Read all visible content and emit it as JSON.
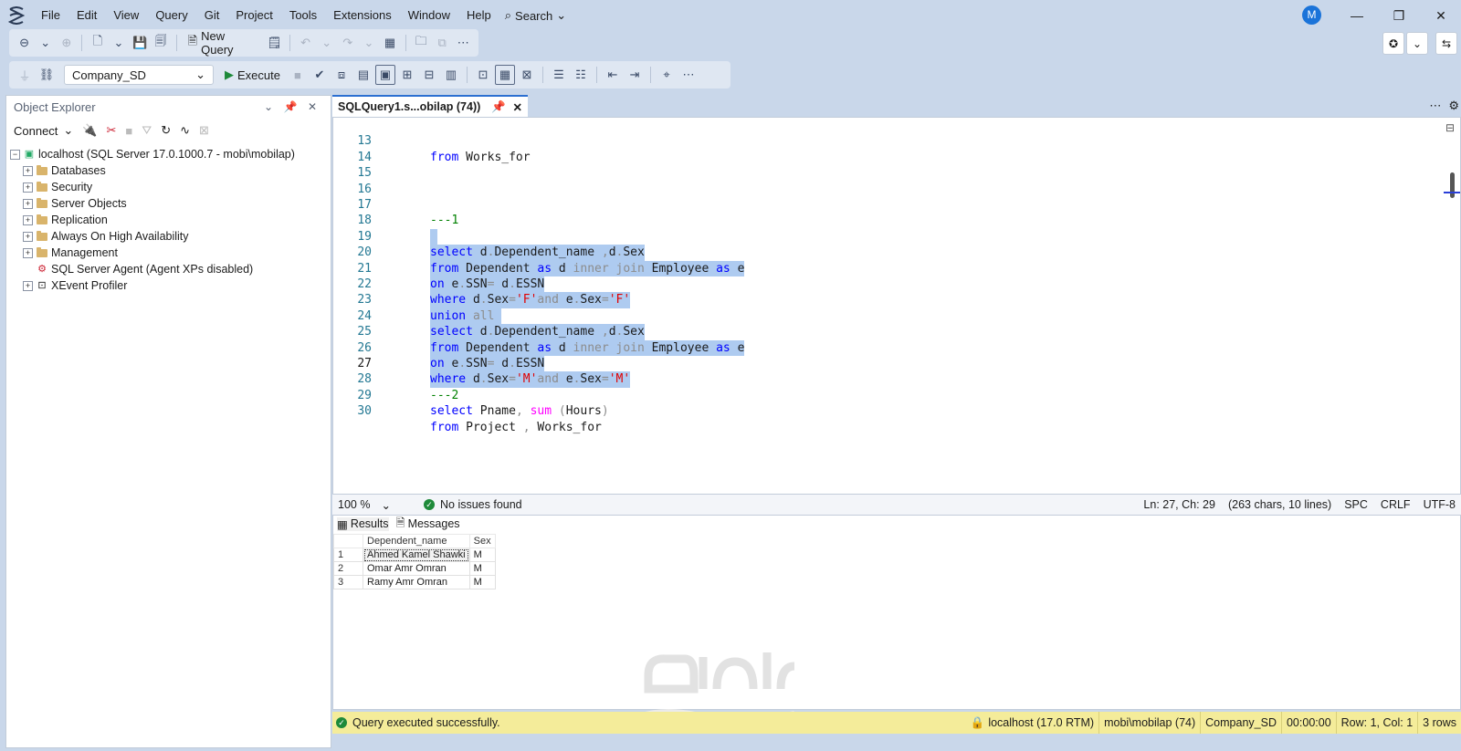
{
  "menu": [
    "File",
    "Edit",
    "View",
    "Query",
    "Git",
    "Project",
    "Tools",
    "Extensions",
    "Window",
    "Help"
  ],
  "search_label": "Search",
  "avatar_initial": "M",
  "toolbar": {
    "new_query": "New Query",
    "database": "Company_SD",
    "execute": "Execute"
  },
  "object_explorer": {
    "title": "Object Explorer",
    "connect": "Connect",
    "server": "localhost (SQL Server 17.0.1000.7 - mobi\\mobilap)",
    "nodes": [
      "Databases",
      "Security",
      "Server Objects",
      "Replication",
      "Always On High Availability",
      "Management",
      "SQL Server Agent (Agent XPs disabled)",
      "XEvent Profiler"
    ]
  },
  "editor": {
    "tab_title": "SQLQuery1.s...obilap (74))",
    "line_numbers": [
      "13",
      "14",
      "15",
      "16",
      "17",
      "18",
      "19",
      "20",
      "21",
      "22",
      "23",
      "24",
      "25",
      "26",
      "27",
      "28",
      "29",
      "30"
    ],
    "code": {
      "l13": [
        "from",
        " Works_for"
      ],
      "l17": "---1",
      "l19": [
        "select",
        " d",
        ".",
        "Dependent_name ",
        ",",
        "d",
        ".",
        "Sex"
      ],
      "l20": [
        "from",
        " Dependent ",
        "as",
        " d ",
        "inner join",
        " Employee ",
        "as",
        " e"
      ],
      "l21": [
        "on",
        " e",
        ".",
        "SSN",
        "=",
        " d",
        ".",
        "ESSN"
      ],
      "l22": [
        "where",
        " d",
        ".",
        "Sex",
        "=",
        "'F'",
        "and",
        " e",
        ".",
        "Sex",
        "=",
        "'F'"
      ],
      "l23": [
        "union",
        " all"
      ],
      "l24": [
        "select",
        " d",
        ".",
        "Dependent_name ",
        ",",
        "d",
        ".",
        "Sex"
      ],
      "l25": [
        "from",
        " Dependent ",
        "as",
        " d ",
        "inner join",
        " Employee ",
        "as",
        " e"
      ],
      "l26": [
        "on",
        " e",
        ".",
        "SSN",
        "=",
        " d",
        ".",
        "ESSN"
      ],
      "l27": [
        "where",
        " d",
        ".",
        "Sex",
        "=",
        "'M'",
        "and",
        " e",
        ".",
        "Sex",
        "=",
        "'M'"
      ],
      "l28": "---2",
      "l29": [
        "select",
        " Pname",
        ",",
        " sum",
        " (",
        "Hours",
        ")"
      ],
      "l30": [
        "from",
        " Project ",
        ",",
        " Works_for"
      ]
    }
  },
  "editor_status": {
    "zoom": "100 %",
    "issues": "No issues found",
    "position": "Ln: 27, Ch: 29",
    "chars": "(263 chars, 10 lines)",
    "spacing": "SPC",
    "eol": "CRLF",
    "encoding": "UTF-8"
  },
  "results": {
    "tab_results": "Results",
    "tab_messages": "Messages",
    "columns": [
      "Dependent_name",
      "Sex"
    ],
    "rows": [
      [
        "1",
        "Ahmed Kamel Shawki",
        "M"
      ],
      [
        "2",
        "Omar Amr Omran",
        "M"
      ],
      [
        "3",
        "Ramy Amr Omran",
        "M"
      ]
    ]
  },
  "status": {
    "message": "Query executed successfully.",
    "server": "localhost (17.0 RTM)",
    "user": "mobi\\mobilap (74)",
    "database": "Company_SD",
    "elapsed": "00:00:00",
    "rowcol": "Row: 1, Col: 1",
    "rows": "3 rows"
  },
  "colors": {
    "keyword": "#0000ff",
    "function": "#ff00ff",
    "string": "#e00000",
    "comment": "#008000",
    "selection": "#aecbf0",
    "status_bar": "#f4ec9a"
  }
}
